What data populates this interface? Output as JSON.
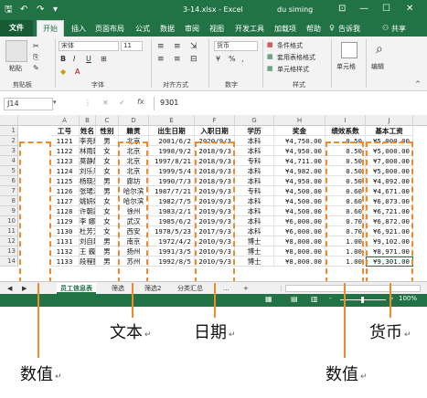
{
  "window": {
    "title": "3-14.xlsx - Excel",
    "user": "du siming",
    "icons": [
      "save-icon",
      "undo-icon",
      "redo-icon",
      "qat-more-icon"
    ]
  },
  "tabs": [
    "文件",
    "开始",
    "插入",
    "页面布局",
    "公式",
    "数据",
    "审阅",
    "视图",
    "开发工具",
    "加载项",
    "帮助",
    "告诉我",
    "共享"
  ],
  "ribbon": {
    "paste": "粘贴",
    "font_name": "宋体",
    "font_size": "11",
    "bold": "B",
    "italic": "I",
    "underline": "U",
    "font_color_glyph": "A",
    "number_format": "货币",
    "percent": "%",
    "comma": ",",
    "cond_format": "条件格式",
    "table_format": "套用表格格式",
    "cell_styles": "单元格样式",
    "cells": "单元格",
    "editing": "编辑",
    "groups": {
      "clipboard": "剪贴板",
      "font": "字体",
      "alignment": "对齐方式",
      "number": "数字",
      "styles": "样式"
    }
  },
  "formula_bar": {
    "name_box": "J14",
    "fx": "fx",
    "value": "9301"
  },
  "columns": [
    "A",
    "B",
    "C",
    "D",
    "E",
    "F",
    "G",
    "H",
    "I",
    "J"
  ],
  "headers": [
    "工号",
    "姓名",
    "性别",
    "籍贯",
    "出生日期",
    "入职日期",
    "学历",
    "奖金",
    "绩效系数",
    "基本工资"
  ],
  "rows": [
    [
      "1121",
      "李亮辉",
      "男",
      "北京",
      "2001/6/2",
      "2020/9/3",
      "本科",
      "¥4,750.00",
      "0.50",
      "¥5,000.00"
    ],
    [
      "1122",
      "林雨馨",
      "女",
      "北京",
      "1998/9/2",
      "2018/9/3",
      "本科",
      "¥4,950.00",
      "0.50",
      "¥5,000.00"
    ],
    [
      "1123",
      "莫静静",
      "女",
      "北京",
      "1997/8/21",
      "2018/9/3",
      "专科",
      "¥4,711.00",
      "0.50",
      "¥7,000.00"
    ],
    [
      "1124",
      "刘乐乐",
      "女",
      "北京",
      "1999/5/4",
      "2018/9/3",
      "本科",
      "¥4,982.00",
      "0.50",
      "¥5,000.00"
    ],
    [
      "1125",
      "杨晓亮",
      "男",
      "廊坊",
      "1990/7/3",
      "2018/9/3",
      "本科",
      "¥4,950.00",
      "0.50",
      "¥4,092.00"
    ],
    [
      "1126",
      "张珺涵",
      "男",
      "哈尔滨",
      "1987/7/21",
      "2019/9/3",
      "专科",
      "¥4,500.00",
      "0.60",
      "¥4,671.00"
    ],
    [
      "1127",
      "姚妍妍",
      "女",
      "哈尔滨",
      "1982/7/5",
      "2019/9/3",
      "本科",
      "¥4,500.00",
      "0.60",
      "¥6,073.00"
    ],
    [
      "1128",
      "许朝霞",
      "女",
      "徐州",
      "1983/2/1",
      "2019/9/3",
      "本科",
      "¥4,500.00",
      "0.60",
      "¥6,721.00"
    ],
    [
      "1129",
      "李  娜",
      "女",
      "武汉",
      "1985/6/2",
      "2019/9/3",
      "本科",
      "¥6,000.00",
      "0.70",
      "¥6,872.00"
    ],
    [
      "1130",
      "杜芳芳",
      "女",
      "西安",
      "1978/5/23",
      "2017/9/3",
      "本科",
      "¥6,000.00",
      "0.70",
      "¥6,921.00"
    ],
    [
      "1131",
      "刘自建",
      "男",
      "南京",
      "1972/4/2",
      "2010/9/3",
      "博士",
      "¥8,000.00",
      "1.00",
      "¥9,102.00"
    ],
    [
      "1132",
      "王  巍",
      "男",
      "扬州",
      "1991/3/5",
      "2010/9/3",
      "博士",
      "¥8,000.00",
      "1.00",
      "¥8,971.00"
    ],
    [
      "1133",
      "段程鹏",
      "男",
      "苏州",
      "1992/8/5",
      "2010/9/3",
      "博士",
      "¥8,000.00",
      "1.00",
      "¥9,301.00"
    ]
  ],
  "sheets": [
    "员工信息表",
    "筛选",
    "筛选2",
    "分类汇总",
    "...",
    "+"
  ],
  "status": {
    "zoom": "100%",
    "minus": "-",
    "plus": "+"
  },
  "annotations": {
    "text": "文本",
    "date": "日期",
    "currency": "货币",
    "number_left": "数值",
    "number_right": "数值",
    "mark": "↵"
  }
}
